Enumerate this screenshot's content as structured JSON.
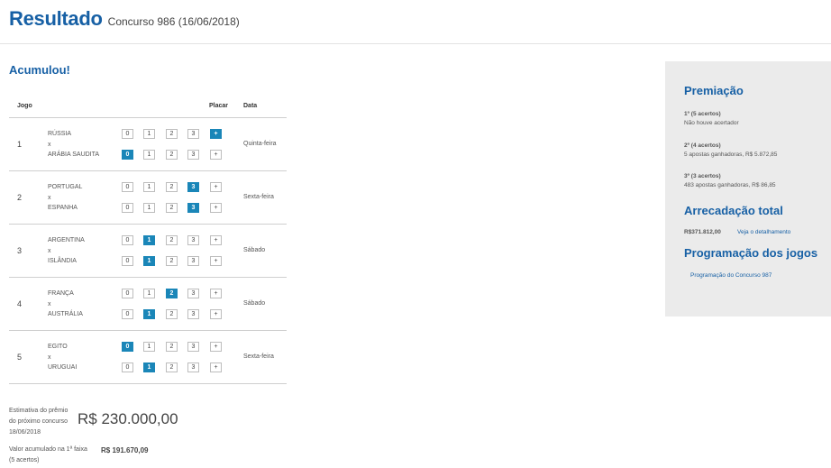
{
  "header": {
    "title": "Resultado",
    "subtitle": "Concurso 986 (16/06/2018)"
  },
  "status": "Acumulou!",
  "table": {
    "col_jogo": "Jogo",
    "col_placar": "Placar",
    "col_data": "Data"
  },
  "games": [
    {
      "num": "1",
      "team_a": "RÚSSIA",
      "vs": "x",
      "team_b": "ARÁBIA SAUDITA",
      "date": "Quinta-feira",
      "score_a": "+",
      "score_b": "0"
    },
    {
      "num": "2",
      "team_a": "PORTUGAL",
      "vs": "x",
      "team_b": "ESPANHA",
      "date": "Sexta-feira",
      "score_a": "3",
      "score_b": "3"
    },
    {
      "num": "3",
      "team_a": "ARGENTINA",
      "vs": "x",
      "team_b": "ISLÂNDIA",
      "date": "Sábado",
      "score_a": "1",
      "score_b": "1"
    },
    {
      "num": "4",
      "team_a": "FRANÇA",
      "vs": "x",
      "team_b": "AUSTRÁLIA",
      "date": "Sábado",
      "score_a": "2",
      "score_b": "1"
    },
    {
      "num": "5",
      "team_a": "EGITO",
      "vs": "x",
      "team_b": "URUGUAI",
      "date": "Sexta-feira",
      "score_a": "0",
      "score_b": "1"
    }
  ],
  "score_options": [
    "0",
    "1",
    "2",
    "3",
    "+"
  ],
  "estimate": {
    "label": "Estimativa do prêmio do próximo concurso 18/06/2018",
    "value": "R$ 230.000,00"
  },
  "accumulated": {
    "label": "Valor acumulado na 1ª faixa (5 acertos)",
    "value": "R$ 191.670,09"
  },
  "sidebar": {
    "premiacao_title": "Premiação",
    "tiers": [
      {
        "title": "1º (5 acertos)",
        "desc": "Não houve acertador"
      },
      {
        "title": "2º (4 acertos)",
        "desc": "5 apostas ganhadoras, R$ 5.872,85"
      },
      {
        "title": "3º (3 acertos)",
        "desc": "483 apostas ganhadoras, R$ 86,85"
      }
    ],
    "arrecadacao_title": "Arrecadação total",
    "arrecadacao_value": "R$371.812,00",
    "arrecadacao_link": "Veja o detalhamento",
    "programacao_title": "Programação dos jogos",
    "programacao_link": "Programação do Concurso 987"
  },
  "colors": {
    "brand": "#1760a5",
    "selected": "#1a86b8",
    "sidebar_bg": "#ebebeb"
  }
}
